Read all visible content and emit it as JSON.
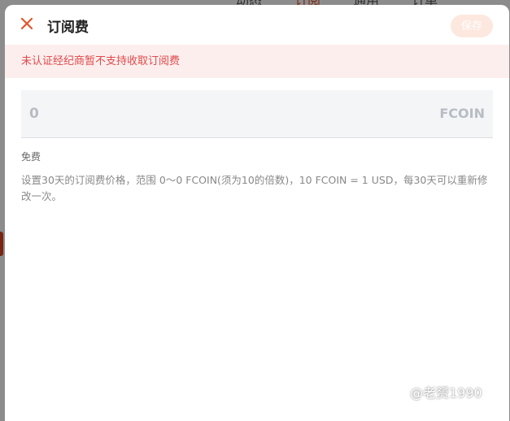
{
  "background": {
    "tabs": [
      "动态",
      "订阅",
      "通用",
      "订单"
    ],
    "active_tab_index": 1
  },
  "modal": {
    "title": "订阅费",
    "save_label": "保存",
    "alert": "未认证经纪商暂不支持收取订阅费",
    "fee_value": "0",
    "fee_unit": "FCOIN",
    "free_label": "免费",
    "description": "设置30天的订阅费价格，范围 0～0 FCOIN(须为10的倍数)，10 FCOIN = 1 USD，每30天可以重新修改一次。"
  },
  "watermark": "@老赟1990",
  "colors": {
    "accent": "#e0552a",
    "alert_text": "#e0494a",
    "alert_bg": "#fdeeee",
    "save_bg_disabled": "#fde8df"
  }
}
